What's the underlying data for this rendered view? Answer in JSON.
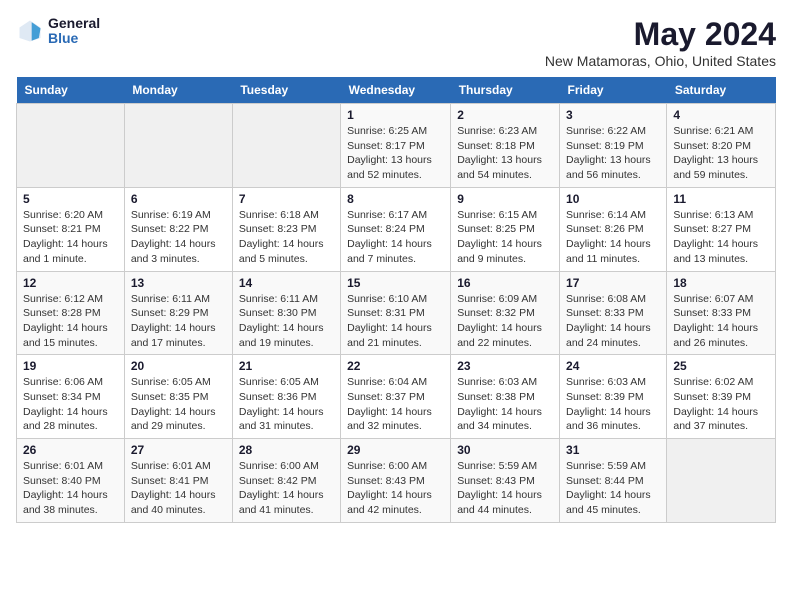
{
  "header": {
    "logo_general": "General",
    "logo_blue": "Blue",
    "title": "May 2024",
    "subtitle": "New Matamoras, Ohio, United States"
  },
  "calendar": {
    "columns": [
      "Sunday",
      "Monday",
      "Tuesday",
      "Wednesday",
      "Thursday",
      "Friday",
      "Saturday"
    ],
    "weeks": [
      [
        {
          "day": "",
          "info": ""
        },
        {
          "day": "",
          "info": ""
        },
        {
          "day": "",
          "info": ""
        },
        {
          "day": "1",
          "info": "Sunrise: 6:25 AM\nSunset: 8:17 PM\nDaylight: 13 hours\nand 52 minutes."
        },
        {
          "day": "2",
          "info": "Sunrise: 6:23 AM\nSunset: 8:18 PM\nDaylight: 13 hours\nand 54 minutes."
        },
        {
          "day": "3",
          "info": "Sunrise: 6:22 AM\nSunset: 8:19 PM\nDaylight: 13 hours\nand 56 minutes."
        },
        {
          "day": "4",
          "info": "Sunrise: 6:21 AM\nSunset: 8:20 PM\nDaylight: 13 hours\nand 59 minutes."
        }
      ],
      [
        {
          "day": "5",
          "info": "Sunrise: 6:20 AM\nSunset: 8:21 PM\nDaylight: 14 hours\nand 1 minute."
        },
        {
          "day": "6",
          "info": "Sunrise: 6:19 AM\nSunset: 8:22 PM\nDaylight: 14 hours\nand 3 minutes."
        },
        {
          "day": "7",
          "info": "Sunrise: 6:18 AM\nSunset: 8:23 PM\nDaylight: 14 hours\nand 5 minutes."
        },
        {
          "day": "8",
          "info": "Sunrise: 6:17 AM\nSunset: 8:24 PM\nDaylight: 14 hours\nand 7 minutes."
        },
        {
          "day": "9",
          "info": "Sunrise: 6:15 AM\nSunset: 8:25 PM\nDaylight: 14 hours\nand 9 minutes."
        },
        {
          "day": "10",
          "info": "Sunrise: 6:14 AM\nSunset: 8:26 PM\nDaylight: 14 hours\nand 11 minutes."
        },
        {
          "day": "11",
          "info": "Sunrise: 6:13 AM\nSunset: 8:27 PM\nDaylight: 14 hours\nand 13 minutes."
        }
      ],
      [
        {
          "day": "12",
          "info": "Sunrise: 6:12 AM\nSunset: 8:28 PM\nDaylight: 14 hours\nand 15 minutes."
        },
        {
          "day": "13",
          "info": "Sunrise: 6:11 AM\nSunset: 8:29 PM\nDaylight: 14 hours\nand 17 minutes."
        },
        {
          "day": "14",
          "info": "Sunrise: 6:11 AM\nSunset: 8:30 PM\nDaylight: 14 hours\nand 19 minutes."
        },
        {
          "day": "15",
          "info": "Sunrise: 6:10 AM\nSunset: 8:31 PM\nDaylight: 14 hours\nand 21 minutes."
        },
        {
          "day": "16",
          "info": "Sunrise: 6:09 AM\nSunset: 8:32 PM\nDaylight: 14 hours\nand 22 minutes."
        },
        {
          "day": "17",
          "info": "Sunrise: 6:08 AM\nSunset: 8:33 PM\nDaylight: 14 hours\nand 24 minutes."
        },
        {
          "day": "18",
          "info": "Sunrise: 6:07 AM\nSunset: 8:33 PM\nDaylight: 14 hours\nand 26 minutes."
        }
      ],
      [
        {
          "day": "19",
          "info": "Sunrise: 6:06 AM\nSunset: 8:34 PM\nDaylight: 14 hours\nand 28 minutes."
        },
        {
          "day": "20",
          "info": "Sunrise: 6:05 AM\nSunset: 8:35 PM\nDaylight: 14 hours\nand 29 minutes."
        },
        {
          "day": "21",
          "info": "Sunrise: 6:05 AM\nSunset: 8:36 PM\nDaylight: 14 hours\nand 31 minutes."
        },
        {
          "day": "22",
          "info": "Sunrise: 6:04 AM\nSunset: 8:37 PM\nDaylight: 14 hours\nand 32 minutes."
        },
        {
          "day": "23",
          "info": "Sunrise: 6:03 AM\nSunset: 8:38 PM\nDaylight: 14 hours\nand 34 minutes."
        },
        {
          "day": "24",
          "info": "Sunrise: 6:03 AM\nSunset: 8:39 PM\nDaylight: 14 hours\nand 36 minutes."
        },
        {
          "day": "25",
          "info": "Sunrise: 6:02 AM\nSunset: 8:39 PM\nDaylight: 14 hours\nand 37 minutes."
        }
      ],
      [
        {
          "day": "26",
          "info": "Sunrise: 6:01 AM\nSunset: 8:40 PM\nDaylight: 14 hours\nand 38 minutes."
        },
        {
          "day": "27",
          "info": "Sunrise: 6:01 AM\nSunset: 8:41 PM\nDaylight: 14 hours\nand 40 minutes."
        },
        {
          "day": "28",
          "info": "Sunrise: 6:00 AM\nSunset: 8:42 PM\nDaylight: 14 hours\nand 41 minutes."
        },
        {
          "day": "29",
          "info": "Sunrise: 6:00 AM\nSunset: 8:43 PM\nDaylight: 14 hours\nand 42 minutes."
        },
        {
          "day": "30",
          "info": "Sunrise: 5:59 AM\nSunset: 8:43 PM\nDaylight: 14 hours\nand 44 minutes."
        },
        {
          "day": "31",
          "info": "Sunrise: 5:59 AM\nSunset: 8:44 PM\nDaylight: 14 hours\nand 45 minutes."
        },
        {
          "day": "",
          "info": ""
        }
      ]
    ]
  }
}
